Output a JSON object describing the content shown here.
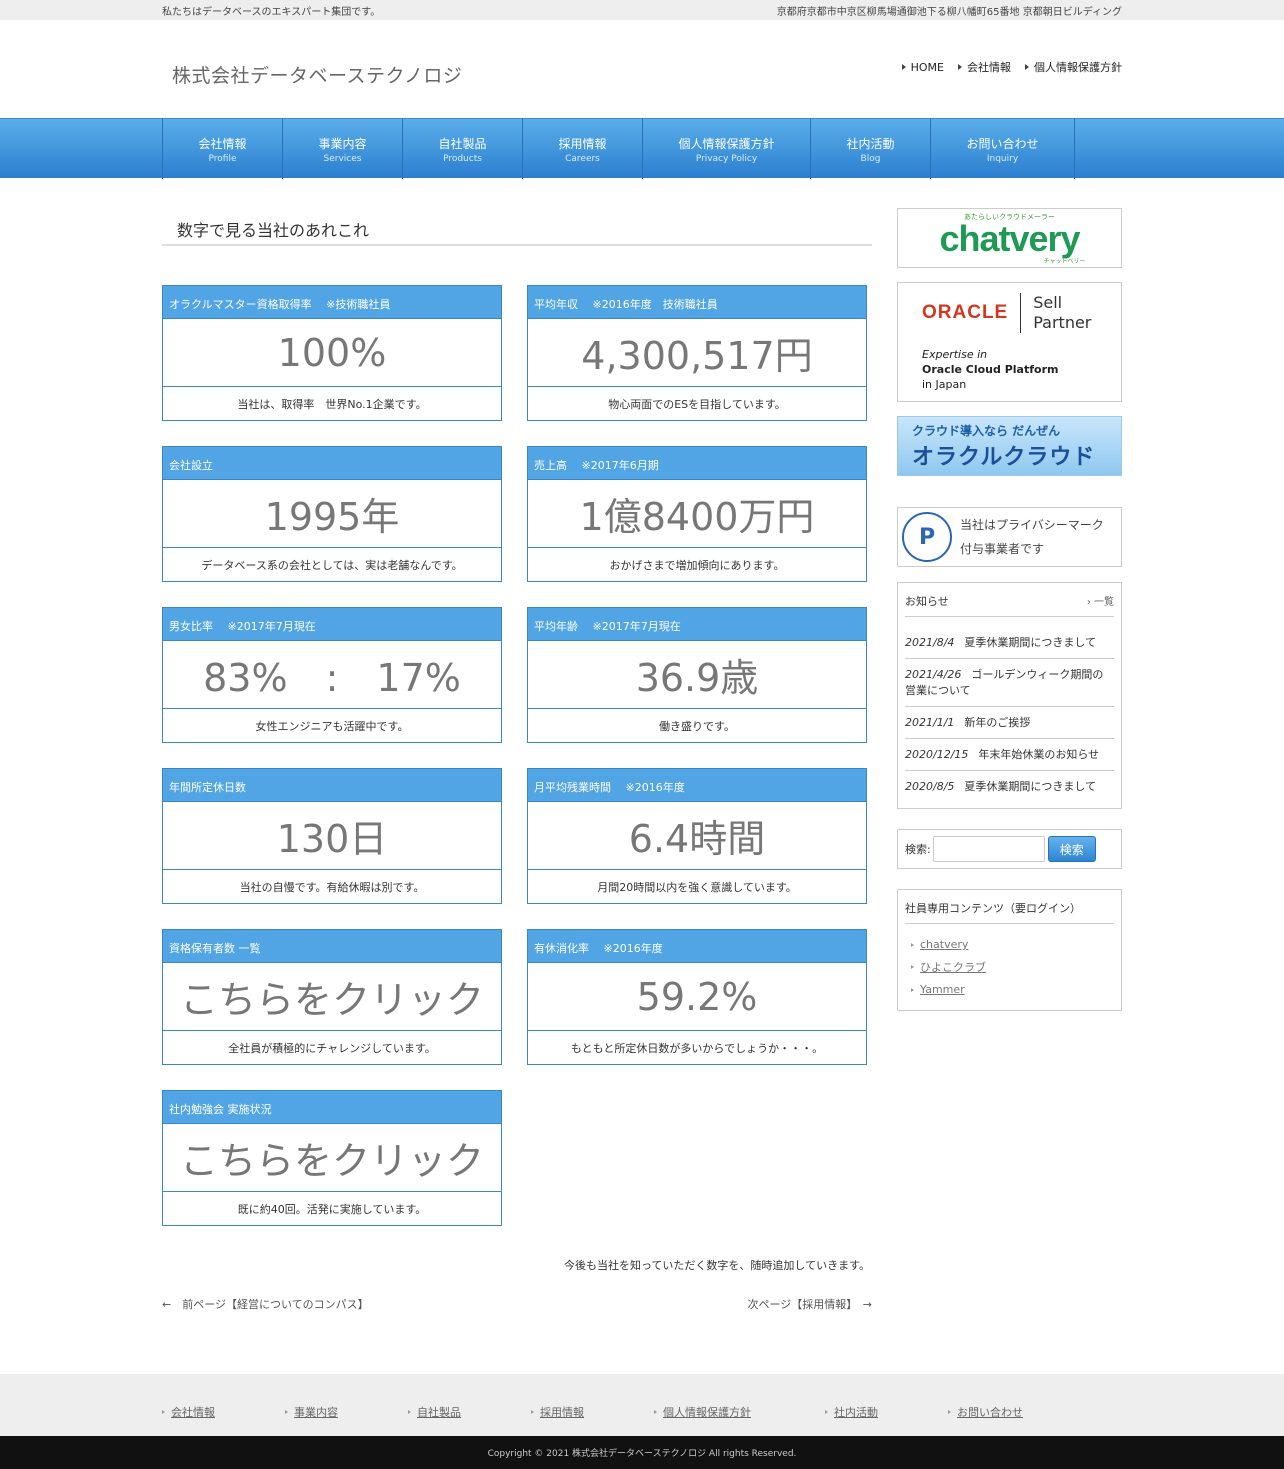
{
  "topbar": {
    "tagline": "私たちはデータベースのエキスパート集団です。",
    "address": "京都府京都市中京区柳馬場通御池下る柳八幡町65番地 京都朝日ビルディング"
  },
  "header": {
    "logo": "株式会社データベーステクノロジ",
    "nav": [
      "HOME",
      "会社情報",
      "個人情報保護方針"
    ]
  },
  "gnav": [
    {
      "jp": "会社情報",
      "en": "Profile"
    },
    {
      "jp": "事業内容",
      "en": "Services"
    },
    {
      "jp": "自社製品",
      "en": "Products"
    },
    {
      "jp": "採用情報",
      "en": "Careers"
    },
    {
      "jp": "個人情報保護方針",
      "en": "Privacy Policy"
    },
    {
      "jp": "社内活動",
      "en": "Blog"
    },
    {
      "jp": "お問い合わせ",
      "en": "Inquiry"
    }
  ],
  "main": {
    "title": "数字で見る当社のあれこれ",
    "cards": [
      {
        "head": "オラクルマスター資格取得率　 ※技術職社員",
        "value": "100%",
        "foot": "当社は、取得率　世界No.1企業です。"
      },
      {
        "head": "平均年収　 ※2016年度　技術職社員",
        "value": "4,300,517円",
        "foot": "物心両面でのESを目指しています。"
      },
      {
        "head": "会社設立",
        "value": "1995年",
        "foot": "データベース系の会社としては、実は老舗なんです。"
      },
      {
        "head": "売上高　 ※2017年6月期",
        "value": "1億8400万円",
        "foot": "おかげさまで増加傾向にあります。"
      },
      {
        "head": "男女比率　 ※2017年7月現在",
        "value": "83%　:　17%",
        "foot": "女性エンジニアも活躍中です。"
      },
      {
        "head": "平均年齢　 ※2017年7月現在",
        "value": "36.9歳",
        "foot": "働き盛りです。"
      },
      {
        "head": "年間所定休日数",
        "value": "130日",
        "foot": "当社の自慢です。有給休暇は別です。"
      },
      {
        "head": "月平均残業時間　 ※2016年度",
        "value": "6.4時間",
        "foot": "月間20時間以内を強く意識しています。"
      },
      {
        "head": "資格保有者数 一覧",
        "value": "こちらをクリック",
        "foot": "全社員が積極的にチャレンジしています。"
      },
      {
        "head": "有休消化率　 ※2016年度",
        "value": "59.2%",
        "foot": "もともと所定休日数が多いからでしょうか・・・。"
      },
      {
        "head": "社内勉強会 実施状況",
        "value": "こちらをクリック",
        "foot": "既に約40回。活発に実施しています。"
      }
    ],
    "note": "今後も当社を知っていただく数字を、随時追加していきます。",
    "prev": "←　前ページ【経営についてのコンパス】",
    "next": "次ページ【採用情報】　→"
  },
  "sidebar": {
    "chatvery": {
      "small": "あたらしいクラウドメーラー",
      "big": "chatvery",
      "kana": "チャットベリー"
    },
    "oracle": {
      "logo": "ORACLE",
      "sell": "Sell",
      "partner": "Partner",
      "exp1": "Expertise in",
      "exp2": "Oracle Cloud Platform",
      "exp3": "in Japan"
    },
    "cloud": {
      "t1": "クラウド導入なら だんぜん",
      "t2": "オラクルクラウド"
    },
    "privacy": {
      "line1": "当社はプライバシーマーク",
      "line2": "付与事業者です"
    },
    "news": {
      "title": "お知らせ",
      "more": "一覧",
      "items": [
        {
          "date": "2021/8/4",
          "text": "夏季休業期間につきまして"
        },
        {
          "date": "2021/4/26",
          "text": "ゴールデンウィーク期間の営業について"
        },
        {
          "date": "2021/1/1",
          "text": "新年のご挨拶"
        },
        {
          "date": "2020/12/15",
          "text": "年末年始休業のお知らせ"
        },
        {
          "date": "2020/8/5",
          "text": "夏季休業期間につきまして"
        }
      ]
    },
    "search": {
      "label": "検索:",
      "button": "検索"
    },
    "members": {
      "title": "社員専用コンテンツ（要ログイン）",
      "links": [
        "chatvery",
        "ひよこクラブ",
        "Yammer"
      ]
    }
  },
  "footer": {
    "links": [
      "会社情報",
      "事業内容",
      "自社製品",
      "採用情報",
      "個人情報保護方針",
      "社内活動",
      "お問い合わせ"
    ],
    "copyright": "Copyright © 2021 株式会社データベーステクノロジ All rights Reserved."
  }
}
